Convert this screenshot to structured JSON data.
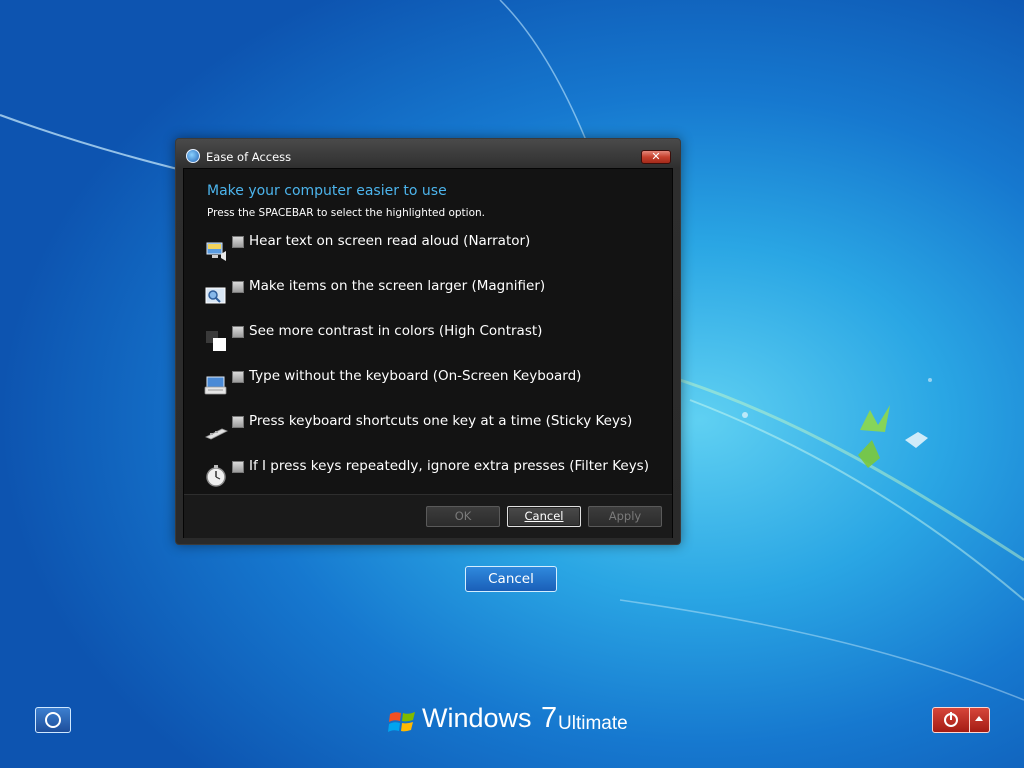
{
  "dialog": {
    "title": "Ease of Access",
    "close_label": "✕",
    "heading": "Make your computer easier to use",
    "hint": "Press the SPACEBAR to select the highlighted option.",
    "options": [
      {
        "label": "Hear text on screen read aloud (Narrator)",
        "icon": "narrator-icon",
        "checked": false
      },
      {
        "label": "Make items on the screen larger (Magnifier)",
        "icon": "magnifier-icon",
        "checked": false
      },
      {
        "label": "See more contrast in colors (High Contrast)",
        "icon": "high-contrast-icon",
        "checked": false
      },
      {
        "label": "Type without the keyboard (On-Screen Keyboard)",
        "icon": "on-screen-keyboard-icon",
        "checked": false
      },
      {
        "label": "Press keyboard shortcuts one key at a time (Sticky Keys)",
        "icon": "sticky-keys-icon",
        "checked": false
      },
      {
        "label": "If I press keys repeatedly, ignore extra presses (Filter Keys)",
        "icon": "filter-keys-icon",
        "checked": false
      }
    ],
    "buttons": {
      "ok": "OK",
      "cancel": "Cancel",
      "apply": "Apply"
    }
  },
  "logon": {
    "cancel_label": "Cancel"
  },
  "branding": {
    "windows": "Windows",
    "version": "7",
    "edition": "Ultimate"
  },
  "icons": {
    "ease_of_access": "ease-of-access-icon",
    "shutdown": "power-icon",
    "shutdown_options": "chevron-up-icon"
  },
  "colors": {
    "heading": "#4cb4ec",
    "shutdown_red": "#c0342a",
    "dialog_bg": "#131313"
  }
}
